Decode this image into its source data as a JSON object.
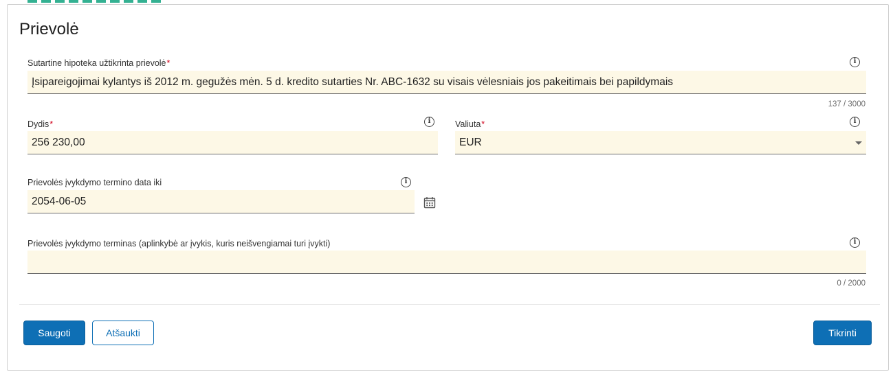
{
  "section": {
    "title": "Prievolė"
  },
  "obligation": {
    "label": "Sutartine hipoteka užtikrinta prievolė",
    "required_mark": "*",
    "value": "Įsipareigojimai kylantys iš 2012 m. gegužės mėn. 5 d. kredito sutarties Nr. ABC-1632 su visais vėlesniais jos pakeitimais bei papildymais",
    "counter": "137 / 3000"
  },
  "amount": {
    "label": "Dydis",
    "required_mark": "*",
    "value": "256 230,00"
  },
  "currency": {
    "label": "Valiuta",
    "required_mark": "*",
    "value": "EUR"
  },
  "due_date": {
    "label": "Prievolės įvykdymo termino data iki",
    "value": "2054-06-05"
  },
  "due_term": {
    "label": "Prievolės įvykdymo terminas (aplinkybė ar įvykis, kuris neišvengiamai turi įvykti)",
    "value": "",
    "counter": "0 / 2000"
  },
  "actions": {
    "save": "Saugoti",
    "cancel": "Atšaukti",
    "check": "Tikrinti"
  },
  "icons": {
    "info": "info-icon",
    "calendar": "calendar-icon",
    "dropdown": "chevron-down-icon"
  },
  "colors": {
    "field_bg": "#fdf8e6",
    "primary": "#0e6fb5",
    "required": "#d0021b"
  }
}
